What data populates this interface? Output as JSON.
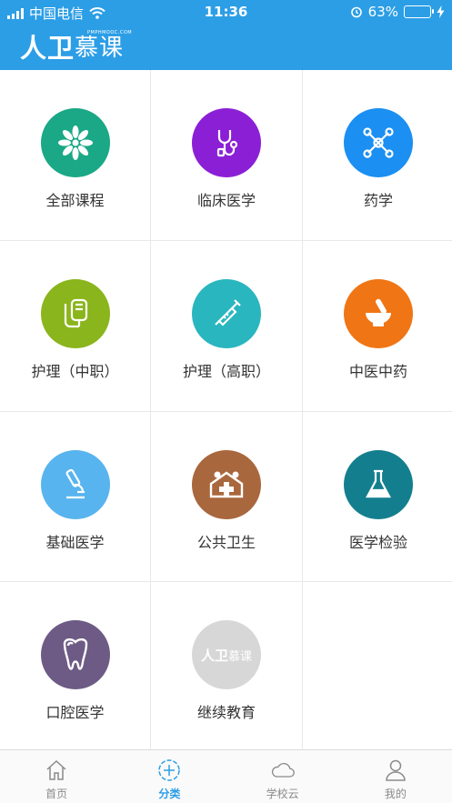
{
  "status_bar": {
    "carrier": "中国电信",
    "time": "11:36",
    "battery_percent": "63%",
    "battery_level": 0.63
  },
  "header": {
    "brand_part1": "人卫",
    "brand_part2": "慕课",
    "brand_small": "PMPHMOOC.COM",
    "bg_color": "#2c9ee6"
  },
  "categories": [
    {
      "label": "全部课程",
      "color": "#1aa886",
      "icon": "flower-icon"
    },
    {
      "label": "临床医学",
      "color": "#8b1fd6",
      "icon": "stethoscope-icon"
    },
    {
      "label": "药学",
      "color": "#1b8ff2",
      "icon": "molecule-icon"
    },
    {
      "label": "护理（中职）",
      "color": "#8ab51c",
      "icon": "iv-drip-icon"
    },
    {
      "label": "护理（高职）",
      "color": "#29b6bf",
      "icon": "syringe-icon"
    },
    {
      "label": "中医中药",
      "color": "#f07514",
      "icon": "mortar-pestle-icon"
    },
    {
      "label": "基础医学",
      "color": "#58b4ee",
      "icon": "microscope-icon"
    },
    {
      "label": "公共卫生",
      "color": "#a9673d",
      "icon": "hospital-icon"
    },
    {
      "label": "医学检验",
      "color": "#137f8e",
      "icon": "flask-icon"
    },
    {
      "label": "口腔医学",
      "color": "#6d5b85",
      "icon": "tooth-icon"
    },
    {
      "label": "继续教育",
      "color": "#d7d7d7",
      "icon": "brand-logo-icon"
    }
  ],
  "tabbar": {
    "items": [
      {
        "label": "首页",
        "icon": "home-icon",
        "active": false
      },
      {
        "label": "分类",
        "icon": "category-plus-icon",
        "active": true
      },
      {
        "label": "学校云",
        "icon": "cloud-icon",
        "active": false
      },
      {
        "label": "我的",
        "icon": "user-icon",
        "active": false
      }
    ],
    "active_color": "#2c9ee6"
  }
}
